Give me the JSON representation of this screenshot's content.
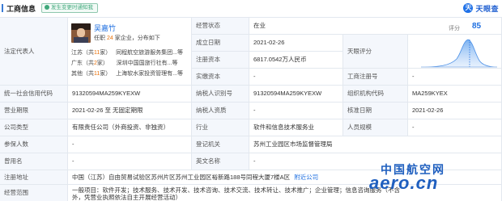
{
  "header": {
    "title": "工商信息",
    "tag": "发生变更时通知我",
    "brand": "天眼查",
    "brand_logo": "天"
  },
  "legal_rep": {
    "label": "法定代表人",
    "name": "吴嘉竹",
    "sub_prefix": "任职",
    "sub_count": "24",
    "sub_suffix": "家企业，分布如下",
    "rows": [
      {
        "region": "江苏（共",
        "count": "11",
        "unit": "家）",
        "company": "同程航空旅游服务集团...等"
      },
      {
        "region": "广东（共",
        "count": "2",
        "unit": "家）",
        "company": "深圳中国国旅行社有...等"
      },
      {
        "region": "其他（共",
        "count": "11",
        "unit": "家）",
        "company": "上海软水家投资管理有...等"
      }
    ]
  },
  "score": {
    "label": "评分",
    "value": "85"
  },
  "labels": {
    "status": "经营状态",
    "established": "成立日期",
    "capital": "注册资本",
    "paid_capital": "实缴资本",
    "reg_no": "工商注册号",
    "rating": "天眼评分",
    "credit_code": "统一社会信用代码",
    "taxpayer_id": "纳税人识别号",
    "org_code": "组织机构代码",
    "term": "营业期限",
    "taxpayer_qual": "纳税人资质",
    "approval_date": "核准日期",
    "company_type": "公司类型",
    "industry": "行业",
    "staff_size": "人员规模",
    "insured": "参保人数",
    "authority": "登记机关",
    "former_name": "曾用名",
    "english_name": "英文名称",
    "address": "注册地址",
    "scope": "经营范围"
  },
  "values": {
    "status": "在业",
    "established": "2021-02-26",
    "capital": "6817.0542万人民币",
    "paid_capital": "-",
    "reg_no": "-",
    "credit_code": "91320594MA259KYEXW",
    "taxpayer_id": "91320594MA259KYEXW",
    "org_code": "MA259KYEX",
    "term": "2021-02-26 至 无固定期限",
    "taxpayer_qual": "-",
    "approval_date": "2021-02-26",
    "company_type": "有限责任公司（外商投资、非独资）",
    "industry": "软件和信息技术服务业",
    "staff_size": "-",
    "insured": "-",
    "authority": "苏州工业园区市场监督管理局",
    "former_name": "-",
    "english_name": "-",
    "address": "中国（江苏）自由贸易试验区苏州片区苏州工业园区裕新路188号同程大厦7楼A区",
    "address_link": "附近公司",
    "scope": "一般项目：软件开发；技术服务、技术开发、技术咨询、技术交流、技术转让、技术推广；企业管理；信息咨询服务（不含",
    "scope_line2": "外，凭营业执照依法自主开展经营活动）"
  },
  "watermark": {
    "cn": "中国航空网",
    "en": "aero.cn"
  }
}
